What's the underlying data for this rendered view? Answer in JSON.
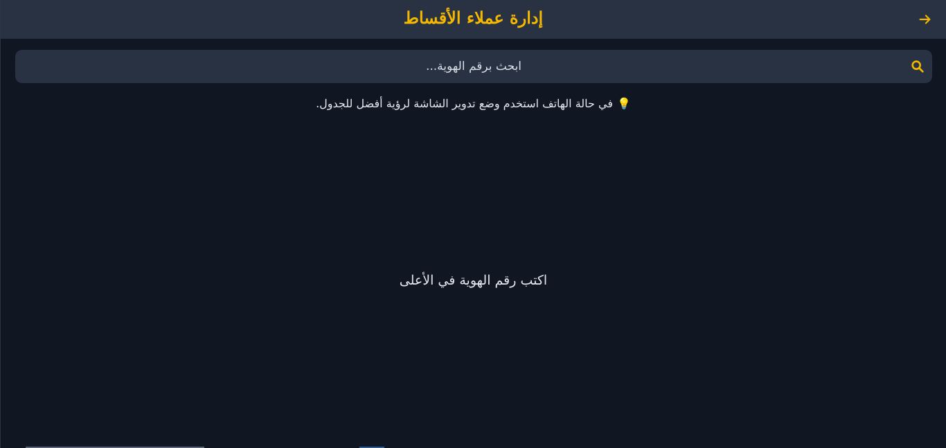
{
  "header": {
    "title": "إدارة عملاء الأقساط",
    "back_icon": "arrow-right-icon",
    "accent_color": "#f5b800"
  },
  "search": {
    "placeholder": "ابحث برقم الهوية...",
    "value": "",
    "icon": "search-icon"
  },
  "tip": {
    "icon": "lightbulb-icon",
    "glyph": "💡",
    "text": "في حالة الهاتف استخدم وضع تدوير الشاشة لرؤية أفضل للجدول."
  },
  "main": {
    "empty_message": "اكتب رقم الهوية في الأعلى"
  }
}
